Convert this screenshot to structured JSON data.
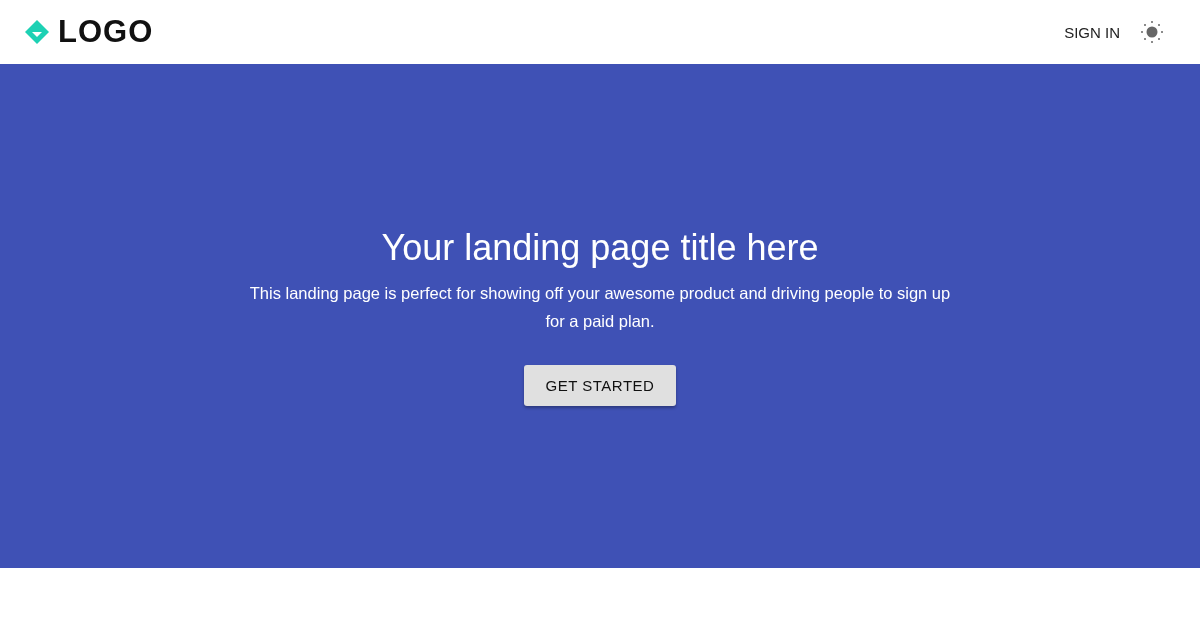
{
  "header": {
    "logo": "LOGO",
    "sign_in": "SIGN IN"
  },
  "hero": {
    "title": "Your landing page title here",
    "subtitle": "This landing page is perfect for showing off your awesome product and driving people to sign up for a paid plan.",
    "button": "GET STARTED"
  }
}
